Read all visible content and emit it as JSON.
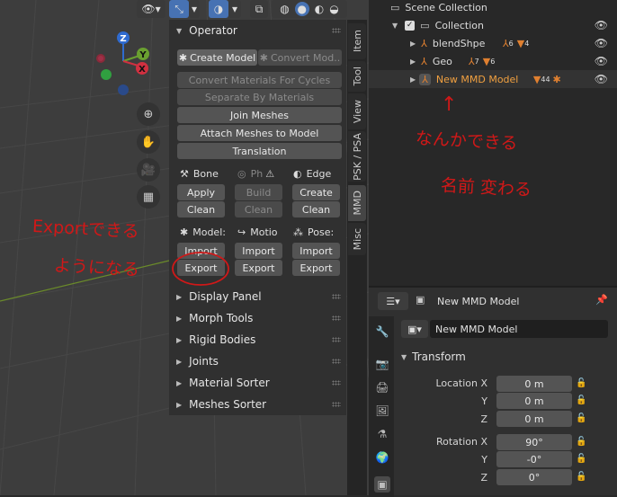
{
  "viewport": {
    "header_icons": [
      "view-icon",
      "transform-icon",
      "overlay-icon",
      "xray-icon",
      "shading-icon"
    ],
    "gizmo": {
      "x": "X",
      "y": "Y",
      "z": "Z"
    },
    "nav_icons": [
      "zoom-icon",
      "pan-hand-icon",
      "camera-icon",
      "grid-icon"
    ]
  },
  "operator_panel": {
    "title": "Operator",
    "create_model": "Create Model",
    "convert_model": "Convert Mod..",
    "convert_materials": "Convert Materials For Cycles",
    "separate_by_materials": "Separate By Materials",
    "join_meshes": "Join Meshes",
    "attach_meshes": "Attach Meshes to Model",
    "translation": "Translation",
    "bone": {
      "label": "Bone",
      "apply": "Apply",
      "clean": "Clean"
    },
    "physics": {
      "label": "Ph",
      "build": "Build",
      "clean": "Clean"
    },
    "edge": {
      "label": "Edge",
      "create": "Create",
      "clean": "Clean"
    },
    "model": {
      "label": "Model:",
      "import": "Import",
      "export": "Export"
    },
    "motion": {
      "label": "Motio",
      "import": "Import",
      "export": "Export"
    },
    "pose": {
      "label": "Pose:",
      "import": "Import",
      "export": "Export"
    }
  },
  "collapsed_panels": [
    "Display Panel",
    "Morph Tools",
    "Rigid Bodies",
    "Joints",
    "Material Sorter",
    "Meshes Sorter"
  ],
  "tabs": [
    "Item",
    "Tool",
    "View",
    "PSK / PSA",
    "MMD",
    "Misc"
  ],
  "outliner": {
    "root": "Scene Collection",
    "collection": "Collection",
    "items": [
      {
        "name": "blendShpe",
        "bone_count": "6",
        "mesh_count": "4"
      },
      {
        "name": "Geo",
        "bone_count": "7",
        "mesh_count": "6"
      },
      {
        "name": "New MMD Model",
        "mesh_count": "44"
      }
    ]
  },
  "properties": {
    "header_object": "New MMD Model",
    "object_name": "New MMD Model",
    "transform_title": "Transform",
    "location_label": "Location X",
    "rotation_label": "Rotation X",
    "axis_y": "Y",
    "axis_z": "Z",
    "location": [
      "0 m",
      "0 m",
      "0 m"
    ],
    "rotation": [
      "90°",
      "-0°",
      "0°"
    ]
  },
  "annotations": {
    "left_line1": "Exportできる",
    "left_line2": "ようになる",
    "right_arrow": "↑",
    "right_line1": "なんかできる",
    "right_line2": "名前 変わる"
  },
  "colors": {
    "active_item": "#f0a040",
    "annotation_red": "#d01818",
    "selected_blue": "#4772b3"
  }
}
